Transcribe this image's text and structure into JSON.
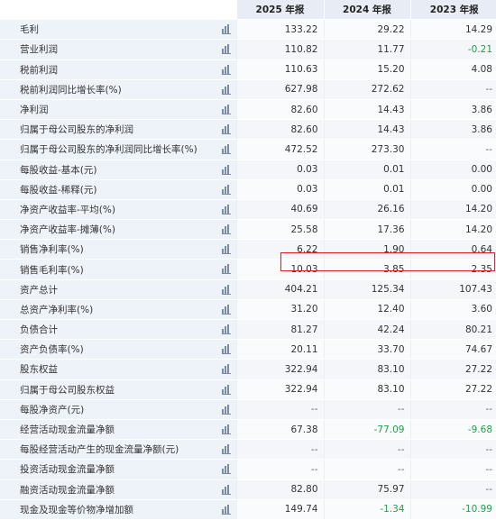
{
  "headers": [
    "",
    "2025 年报",
    "2024 年报",
    "2023 年报"
  ],
  "highlight_color": "#e02020",
  "rows": [
    {
      "label": "毛利",
      "values": [
        "133.22",
        "29.22",
        "14.29"
      ]
    },
    {
      "label": "营业利润",
      "values": [
        "110.82",
        "11.77",
        "-0.21"
      ]
    },
    {
      "label": "税前利润",
      "values": [
        "110.63",
        "15.20",
        "4.08"
      ]
    },
    {
      "label": "税前利润同比增长率(%)",
      "values": [
        "627.98",
        "272.62",
        "--"
      ]
    },
    {
      "label": "净利润",
      "values": [
        "82.60",
        "14.43",
        "3.86"
      ]
    },
    {
      "label": "归属于母公司股东的净利润",
      "values": [
        "82.60",
        "14.43",
        "3.86"
      ]
    },
    {
      "label": "归属于母公司股东的净利润同比增长率(%)",
      "values": [
        "472.52",
        "273.30",
        "--"
      ]
    },
    {
      "label": "每股收益-基本(元)",
      "values": [
        "0.03",
        "0.01",
        "0.00"
      ]
    },
    {
      "label": "每股收益-稀释(元)",
      "values": [
        "0.03",
        "0.01",
        "0.00"
      ]
    },
    {
      "label": "净资产收益率-平均(%)",
      "values": [
        "40.69",
        "26.16",
        "14.20"
      ]
    },
    {
      "label": "净资产收益率-摊薄(%)",
      "values": [
        "25.58",
        "17.36",
        "14.20"
      ]
    },
    {
      "label": "销售净利率(%)",
      "values": [
        "6.22",
        "1.90",
        "0.64"
      ]
    },
    {
      "label": "销售毛利率(%)",
      "values": [
        "10.03",
        "3.85",
        "2.35"
      ]
    },
    {
      "label": "资产总计",
      "values": [
        "404.21",
        "125.34",
        "107.43"
      ]
    },
    {
      "label": "总资产净利率(%)",
      "values": [
        "31.20",
        "12.40",
        "3.60"
      ]
    },
    {
      "label": "负债合计",
      "values": [
        "81.27",
        "42.24",
        "80.21"
      ]
    },
    {
      "label": "资产负债率(%)",
      "values": [
        "20.11",
        "33.70",
        "74.67"
      ]
    },
    {
      "label": "股东权益",
      "values": [
        "322.94",
        "83.10",
        "27.22"
      ]
    },
    {
      "label": "归属于母公司股东权益",
      "values": [
        "322.94",
        "83.10",
        "27.22"
      ]
    },
    {
      "label": "每股净资产(元)",
      "values": [
        "--",
        "--",
        "--"
      ]
    },
    {
      "label": "经营活动现金流量净额",
      "values": [
        "67.38",
        "-77.09",
        "-9.68"
      ]
    },
    {
      "label": "每股经营活动产生的现金流量净额(元)",
      "values": [
        "--",
        "--",
        "--"
      ]
    },
    {
      "label": "投资活动现金流量净额",
      "values": [
        "--",
        "--",
        "--"
      ]
    },
    {
      "label": "融资活动现金流量净额",
      "values": [
        "82.80",
        "75.97",
        "--"
      ]
    },
    {
      "label": "现金及现金等价物净增加额",
      "values": [
        "149.74",
        "-1.34",
        "-10.99"
      ]
    }
  ]
}
